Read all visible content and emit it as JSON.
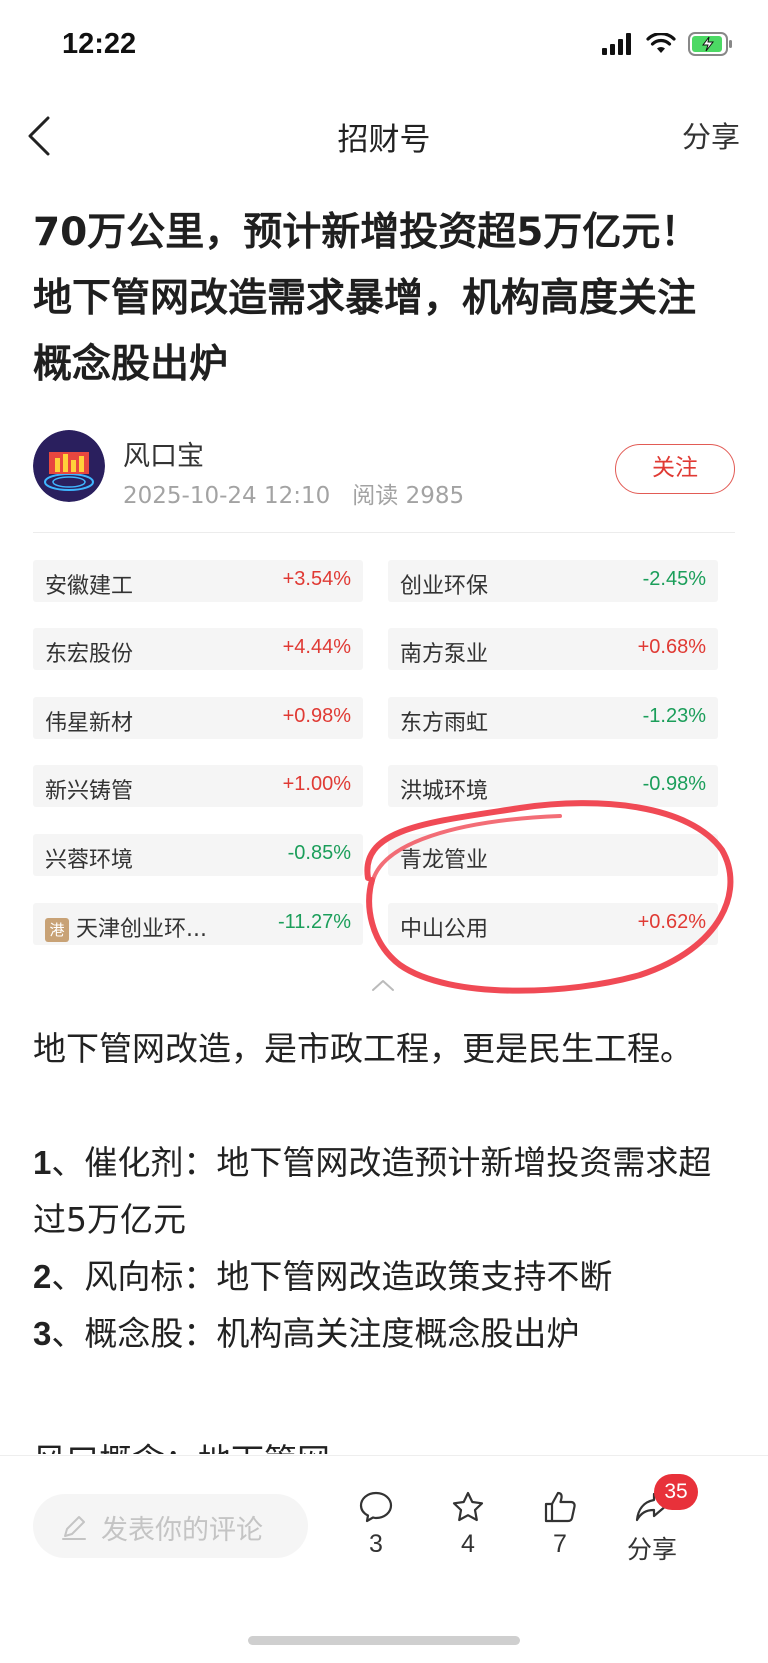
{
  "status_bar": {
    "time": "12:22"
  },
  "nav": {
    "title": "招财号",
    "share": "分享"
  },
  "article": {
    "title": "70万公里，预计新增投资超5万亿元！地下管网改造需求暴增，机构高度关注概念股出炉"
  },
  "author": {
    "name": "风口宝",
    "datetime": "2025-10-24 12:10",
    "read_label": "阅读 2985",
    "follow_label": "关注"
  },
  "stocks": [
    {
      "name": "安徽建工",
      "change": "+3.54%",
      "direction": "up",
      "hk": false
    },
    {
      "name": "创业环保",
      "change": "-2.45%",
      "direction": "down",
      "hk": false
    },
    {
      "name": "东宏股份",
      "change": "+4.44%",
      "direction": "up",
      "hk": false
    },
    {
      "name": "南方泵业",
      "change": "+0.68%",
      "direction": "up",
      "hk": false
    },
    {
      "name": "伟星新材",
      "change": "+0.98%",
      "direction": "up",
      "hk": false
    },
    {
      "name": "东方雨虹",
      "change": "-1.23%",
      "direction": "down",
      "hk": false
    },
    {
      "name": "新兴铸管",
      "change": "+1.00%",
      "direction": "up",
      "hk": false
    },
    {
      "name": "洪城环境",
      "change": "-0.98%",
      "direction": "down",
      "hk": false
    },
    {
      "name": "兴蓉环境",
      "change": "-0.85%",
      "direction": "down",
      "hk": false
    },
    {
      "name": "青龙管业",
      "change": "",
      "direction": "up",
      "hk": false
    },
    {
      "name": "天津创业环...",
      "change": "-11.27%",
      "direction": "down",
      "hk": true,
      "badge": "港"
    },
    {
      "name": "中山公用",
      "change": "+0.62%",
      "direction": "up",
      "hk": false
    }
  ],
  "content": {
    "p1": "地下管网改造，是市政工程，更是民生工程。",
    "l1_num": "1",
    "l1": "、催化剂：地下管网改造预计新增投资需求超过5万亿元",
    "l2_num": "2",
    "l2": "、风向标：地下管网改造政策支持不断",
    "l3_num": "3",
    "l3": "、概念股：机构高关注度概念股出炉",
    "l4": "风口概念：地下管网"
  },
  "bottom_bar": {
    "comment_placeholder": "发表你的评论",
    "comments": "3",
    "favorites": "4",
    "likes": "7",
    "share_label": "分享",
    "share_badge": "35"
  },
  "colors": {
    "up": "#e03a34",
    "down": "#1b9e5a",
    "annotation": "#f04a55"
  }
}
